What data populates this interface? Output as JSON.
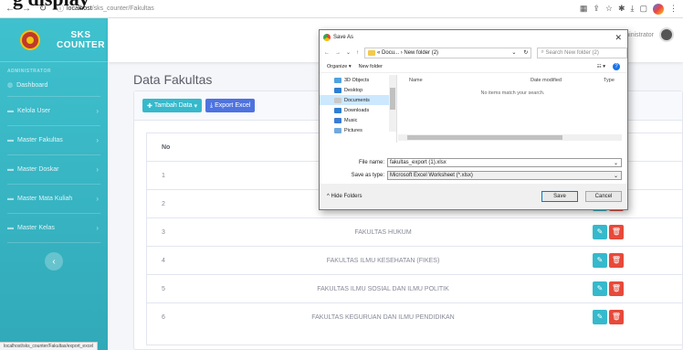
{
  "overflow_heading": "g display",
  "browser": {
    "url_host": "localhost",
    "url_path": "/sks_counter/Fakultas",
    "status_url": "localhost/sks_counter/Fakultas/export_excel"
  },
  "sidebar": {
    "brand_line1": "SKS",
    "brand_line2": "COUNTER",
    "section_label": "ADMINISTRATOR",
    "items": [
      {
        "label": "Dashboard"
      },
      {
        "label": "Kelola User"
      },
      {
        "label": "Master Fakultas"
      },
      {
        "label": "Master Doskar"
      },
      {
        "label": "Master Mata Kuliah"
      },
      {
        "label": "Master Kelas"
      }
    ]
  },
  "topbar": {
    "user_name": "Administrator"
  },
  "main": {
    "title": "Data Fakultas",
    "add_button": "Tambah Data",
    "export_button": "Export Excel",
    "table_headers": {
      "no": "No"
    },
    "rows": [
      {
        "no": "1",
        "name": ""
      },
      {
        "no": "2",
        "name": ""
      },
      {
        "no": "3",
        "name": "FAKULTAS HUKUM"
      },
      {
        "no": "4",
        "name": "FAKULTAS ILMU KESEHATAN (FIKES)"
      },
      {
        "no": "5",
        "name": "FAKULTAS ILMU SOSIAL DAN ILMU POLITIK"
      },
      {
        "no": "6",
        "name": "FAKULTAS KEGURUAN DAN ILMU PENDIDIKAN"
      }
    ]
  },
  "dialog": {
    "title": "Save As",
    "path": "« Docu... › New folder (2)",
    "search_placeholder": "Search New folder (2)",
    "organize": "Organize ▾",
    "new_folder": "New folder",
    "tree_items": [
      {
        "label": "3D Objects",
        "color": "#4fa3e0"
      },
      {
        "label": "Desktop",
        "color": "#2d7fd3"
      },
      {
        "label": "Documents",
        "color": "#c9c9c9"
      },
      {
        "label": "Downloads",
        "color": "#2d7fd3"
      },
      {
        "label": "Music",
        "color": "#3a7bd5"
      },
      {
        "label": "Pictures",
        "color": "#6fa9e0"
      }
    ],
    "col_name": "Name",
    "col_date": "Date modified",
    "col_type": "Type",
    "empty_message": "No items match your search.",
    "file_name_label": "File name:",
    "file_name_value": "fakultas_export (1).xlsx",
    "save_type_label": "Save as type:",
    "save_type_value": "Microsoft Excel Worksheet (*.xlsx)",
    "hide_folders": "Hide Folders",
    "save_button": "Save",
    "cancel_button": "Cancel"
  }
}
